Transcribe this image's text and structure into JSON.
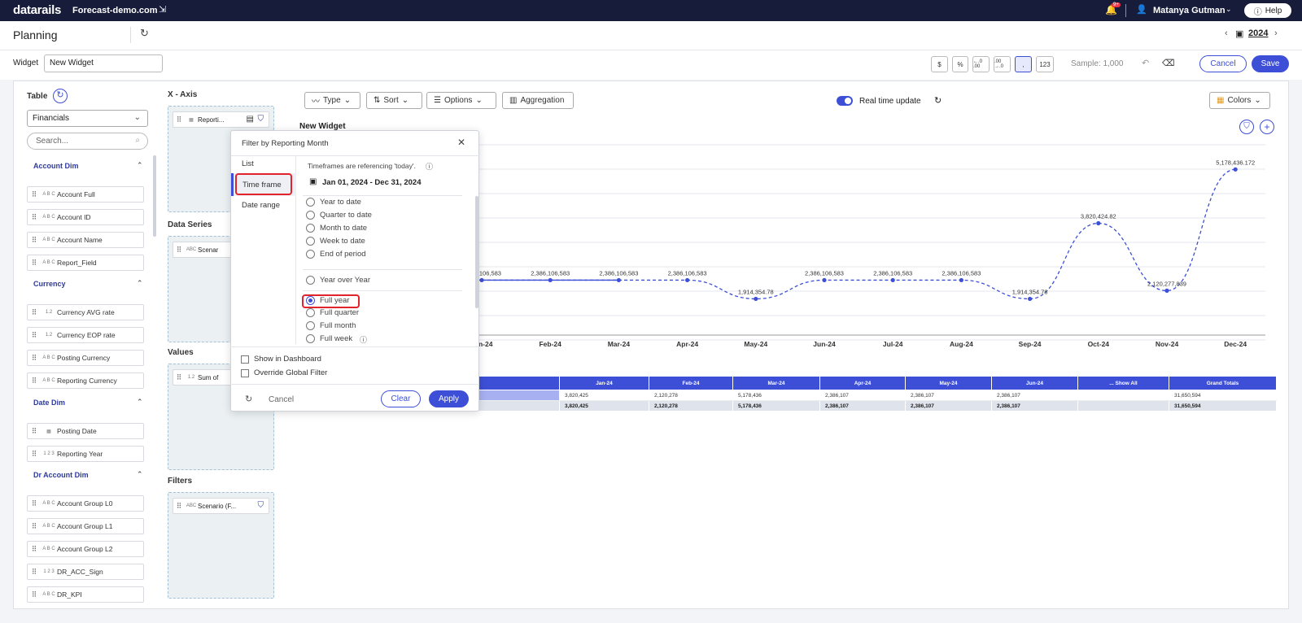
{
  "topbar": {
    "logo": "datarails",
    "site": "Forecast-demo.com",
    "bell_badge": "9+",
    "user": "Matanya Gutman",
    "help": "Help"
  },
  "planning": {
    "title": "Planning",
    "year": "2024"
  },
  "widget": {
    "label": "Widget",
    "name": "New Widget",
    "format_buttons": [
      "$",
      "%",
      "←.0 .00",
      ".00 →.0",
      ",",
      "123"
    ],
    "sample": "Sample: 1,000",
    "cancel": "Cancel",
    "save": "Save"
  },
  "sidebar": {
    "table_label": "Table",
    "table_value": "Financials",
    "search_placeholder": "Search...",
    "groups": [
      {
        "name": "Account Dim",
        "fields": [
          {
            "t": "A B C",
            "n": "Account Full"
          },
          {
            "t": "A B C",
            "n": "Account ID"
          },
          {
            "t": "A B C",
            "n": "Account Name"
          },
          {
            "t": "A B C",
            "n": "Report_Field"
          }
        ]
      },
      {
        "name": "Currency",
        "fields": [
          {
            "t": "1.2",
            "n": "Currency AVG rate"
          },
          {
            "t": "1.2",
            "n": "Currency EOP rate"
          },
          {
            "t": "A B C",
            "n": "Posting Currency"
          },
          {
            "t": "A B C",
            "n": "Reporting Currency"
          }
        ]
      },
      {
        "name": "Date Dim",
        "fields": [
          {
            "t": "▦",
            "n": "Posting Date"
          },
          {
            "t": "1 2 3",
            "n": "Reporting Year"
          }
        ]
      },
      {
        "name": "Dr Account Dim",
        "fields": [
          {
            "t": "A B C",
            "n": "Account Group L0"
          },
          {
            "t": "A B C",
            "n": "Account Group L1"
          },
          {
            "t": "A B C",
            "n": "Account Group L2"
          },
          {
            "t": "1 2 3",
            "n": "DR_ACC_Sign"
          },
          {
            "t": "A B C",
            "n": "DR_KPI"
          }
        ]
      }
    ]
  },
  "zones": {
    "xaxis": {
      "title": "X - Axis",
      "chip": "Reporti..."
    },
    "series": {
      "title": "Data Series",
      "chip": "Scenar"
    },
    "values": {
      "title": "Values",
      "chip": "Sum of"
    },
    "filters": {
      "title": "Filters",
      "chip": "Scenario (F..."
    }
  },
  "toolbar": {
    "type": "Type",
    "sort": "Sort",
    "options": "Options",
    "aggregation": "Aggregation",
    "rtu": "Real time update",
    "colors": "Colors"
  },
  "chart_title": "New Widget",
  "chart_data": {
    "type": "line",
    "categories": [
      "Jan-24",
      "Feb-24",
      "Mar-24",
      "Apr-24",
      "May-24",
      "Jun-24",
      "Jul-24",
      "Aug-24",
      "Sep-24",
      "Oct-24",
      "Nov-24",
      "Dec-24"
    ],
    "values": [
      2386106.583,
      2386106.583,
      2386106.583,
      2386106.583,
      1914354.78,
      2386106.583,
      2386106.583,
      2386106.583,
      1914354.78,
      3820424.82,
      2120277.839,
      5178436.172
    ],
    "data_labels": [
      "2,386,106,583",
      "2,386,106,583",
      "2,386,106,583",
      "2,386,106,583",
      "1,914,354.78",
      "2,386,106,583",
      "2,386,106,583",
      "2,386,106,583",
      "1,914,354.78",
      "3,820,424.82",
      "2,120,277,839",
      "5,178,436.172"
    ],
    "visible_label_first": "06,583",
    "visible_tick_first": "n-24",
    "ylim": [
      1000000,
      5800000
    ]
  },
  "pivot": {
    "header": [
      "",
      "Jan-24",
      "Feb-24",
      "Mar-24",
      "Apr-24",
      "May-24",
      "Jun-24",
      "... Show All",
      "Grand Totals"
    ],
    "row": [
      "",
      "3,820,425",
      "2,120,278",
      "5,178,436",
      "2,386,107",
      "2,386,107",
      "2,386,107",
      "",
      "31,650,594"
    ],
    "totals": [
      "Grand Totals",
      "3,820,425",
      "2,120,278",
      "5,178,436",
      "2,386,107",
      "2,386,107",
      "2,386,107",
      "",
      "31,650,594"
    ]
  },
  "modal": {
    "title": "Filter by Reporting Month",
    "tabs": [
      "List",
      "Time frame",
      "Date range"
    ],
    "note": "Timeframes are referencing 'today'.",
    "range": "Jan 01, 2024 - Dec 31, 2024",
    "options_a": [
      "Year to date",
      "Quarter to date",
      "Month to date",
      "Week to date",
      "End of period"
    ],
    "option_yoy": "Year over Year",
    "options_b": [
      "Full year",
      "Full quarter",
      "Full month",
      "Full week"
    ],
    "selected": "Full year",
    "show_dashboard": "Show in Dashboard",
    "override": "Override Global Filter",
    "cancel": "Cancel",
    "clear": "Clear",
    "apply": "Apply"
  },
  "colors": {
    "accent": "#3d4fd6",
    "topbar": "#161c3a",
    "highlight": "#e1232b"
  }
}
